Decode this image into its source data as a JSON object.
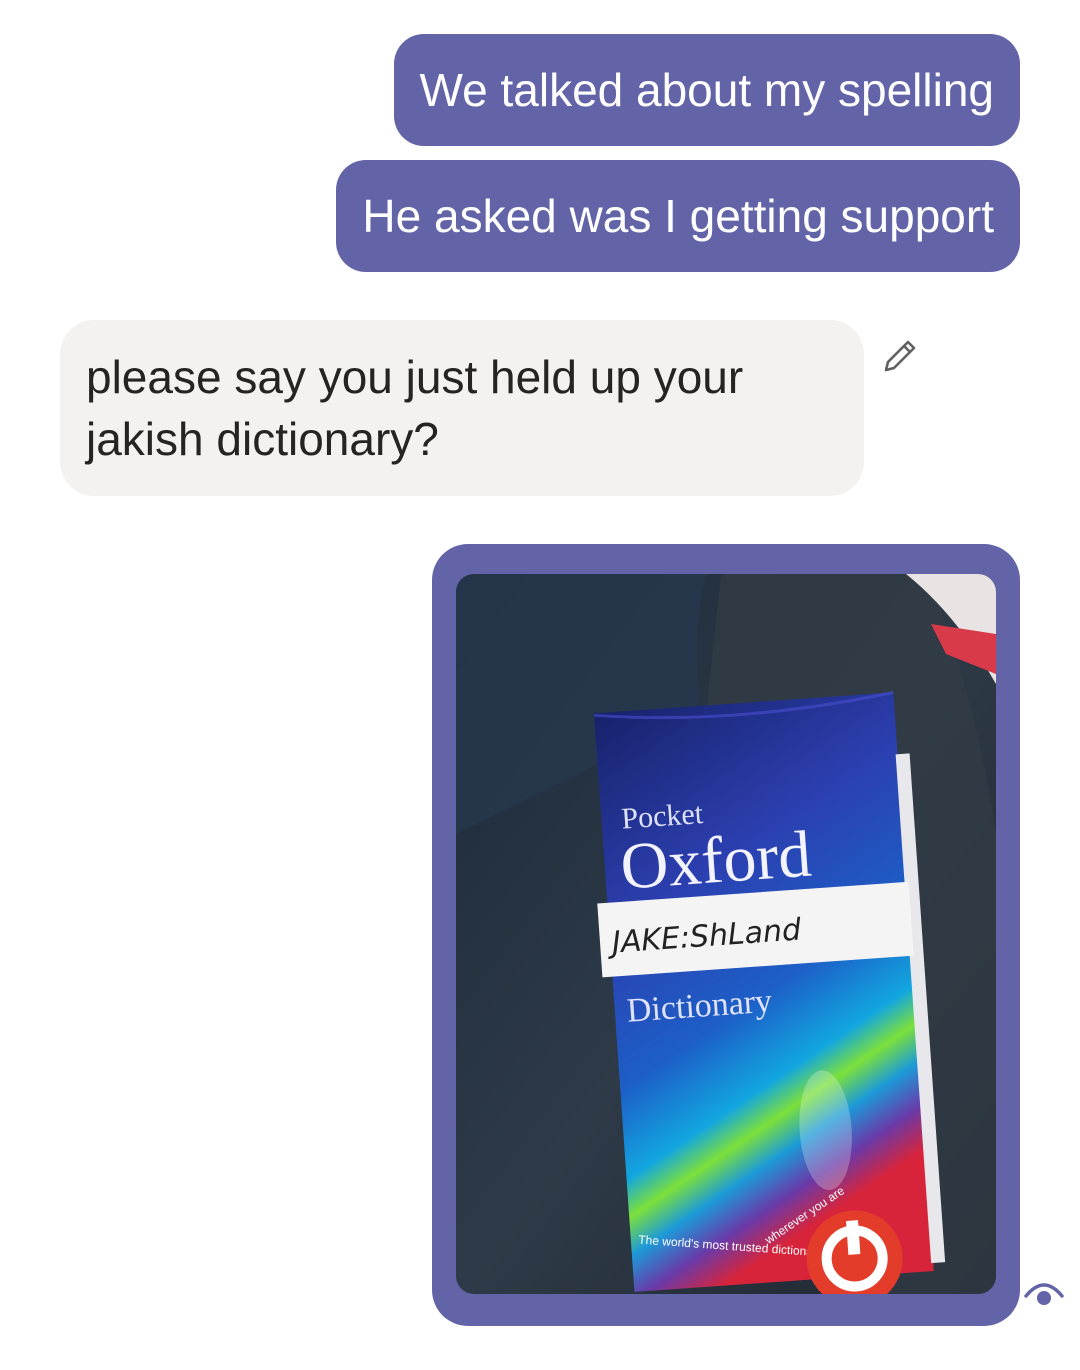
{
  "conversation": {
    "messages": [
      {
        "direction": "sent",
        "text": "We talked about my spelling"
      },
      {
        "direction": "sent",
        "text": "He asked was I getting support"
      },
      {
        "direction": "received",
        "text": "please say you just held up your jakish dictionary?"
      }
    ],
    "image_message": {
      "direction": "sent",
      "photo": {
        "book_line1": "Pocket",
        "book_line2": "Oxford",
        "label_handwriting": "JAKE:ShLand",
        "book_line3": "Dictionary",
        "tagline": "The world's most trusted dictionaries",
        "slogan": "wherever you are"
      }
    }
  },
  "icons": {
    "edit": "pencil-icon",
    "read_receipt": "seen-eye-icon"
  },
  "colors": {
    "sent_bubble": "#6264a7",
    "received_bubble": "#f3f2f1",
    "received_text": "#252423",
    "sent_text": "#ffffff"
  }
}
